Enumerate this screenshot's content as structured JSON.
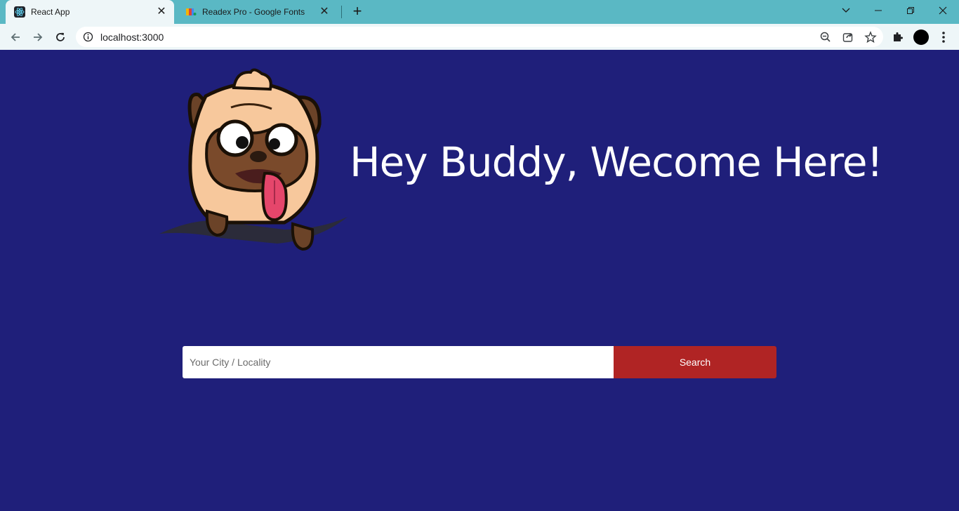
{
  "browser": {
    "tabs": [
      {
        "title": "React App",
        "favicon": "react-icon",
        "active": true
      },
      {
        "title": "Readex Pro - Google Fonts",
        "favicon": "google-fonts-icon",
        "active": false
      }
    ],
    "new_tab_label": "+",
    "address": {
      "url": "localhost:3000"
    },
    "colors": {
      "tabbar": "#5ab8c4",
      "toolbar": "#eef6f8"
    }
  },
  "page": {
    "heading": "Hey Buddy, Wecome Here!",
    "mascot": "pug-dog-illustration",
    "search": {
      "placeholder": "Your City / Locality",
      "value": "",
      "button_label": "Search"
    },
    "colors": {
      "background": "#1f1f7a",
      "button": "#b02424",
      "text": "#ffffff"
    }
  }
}
